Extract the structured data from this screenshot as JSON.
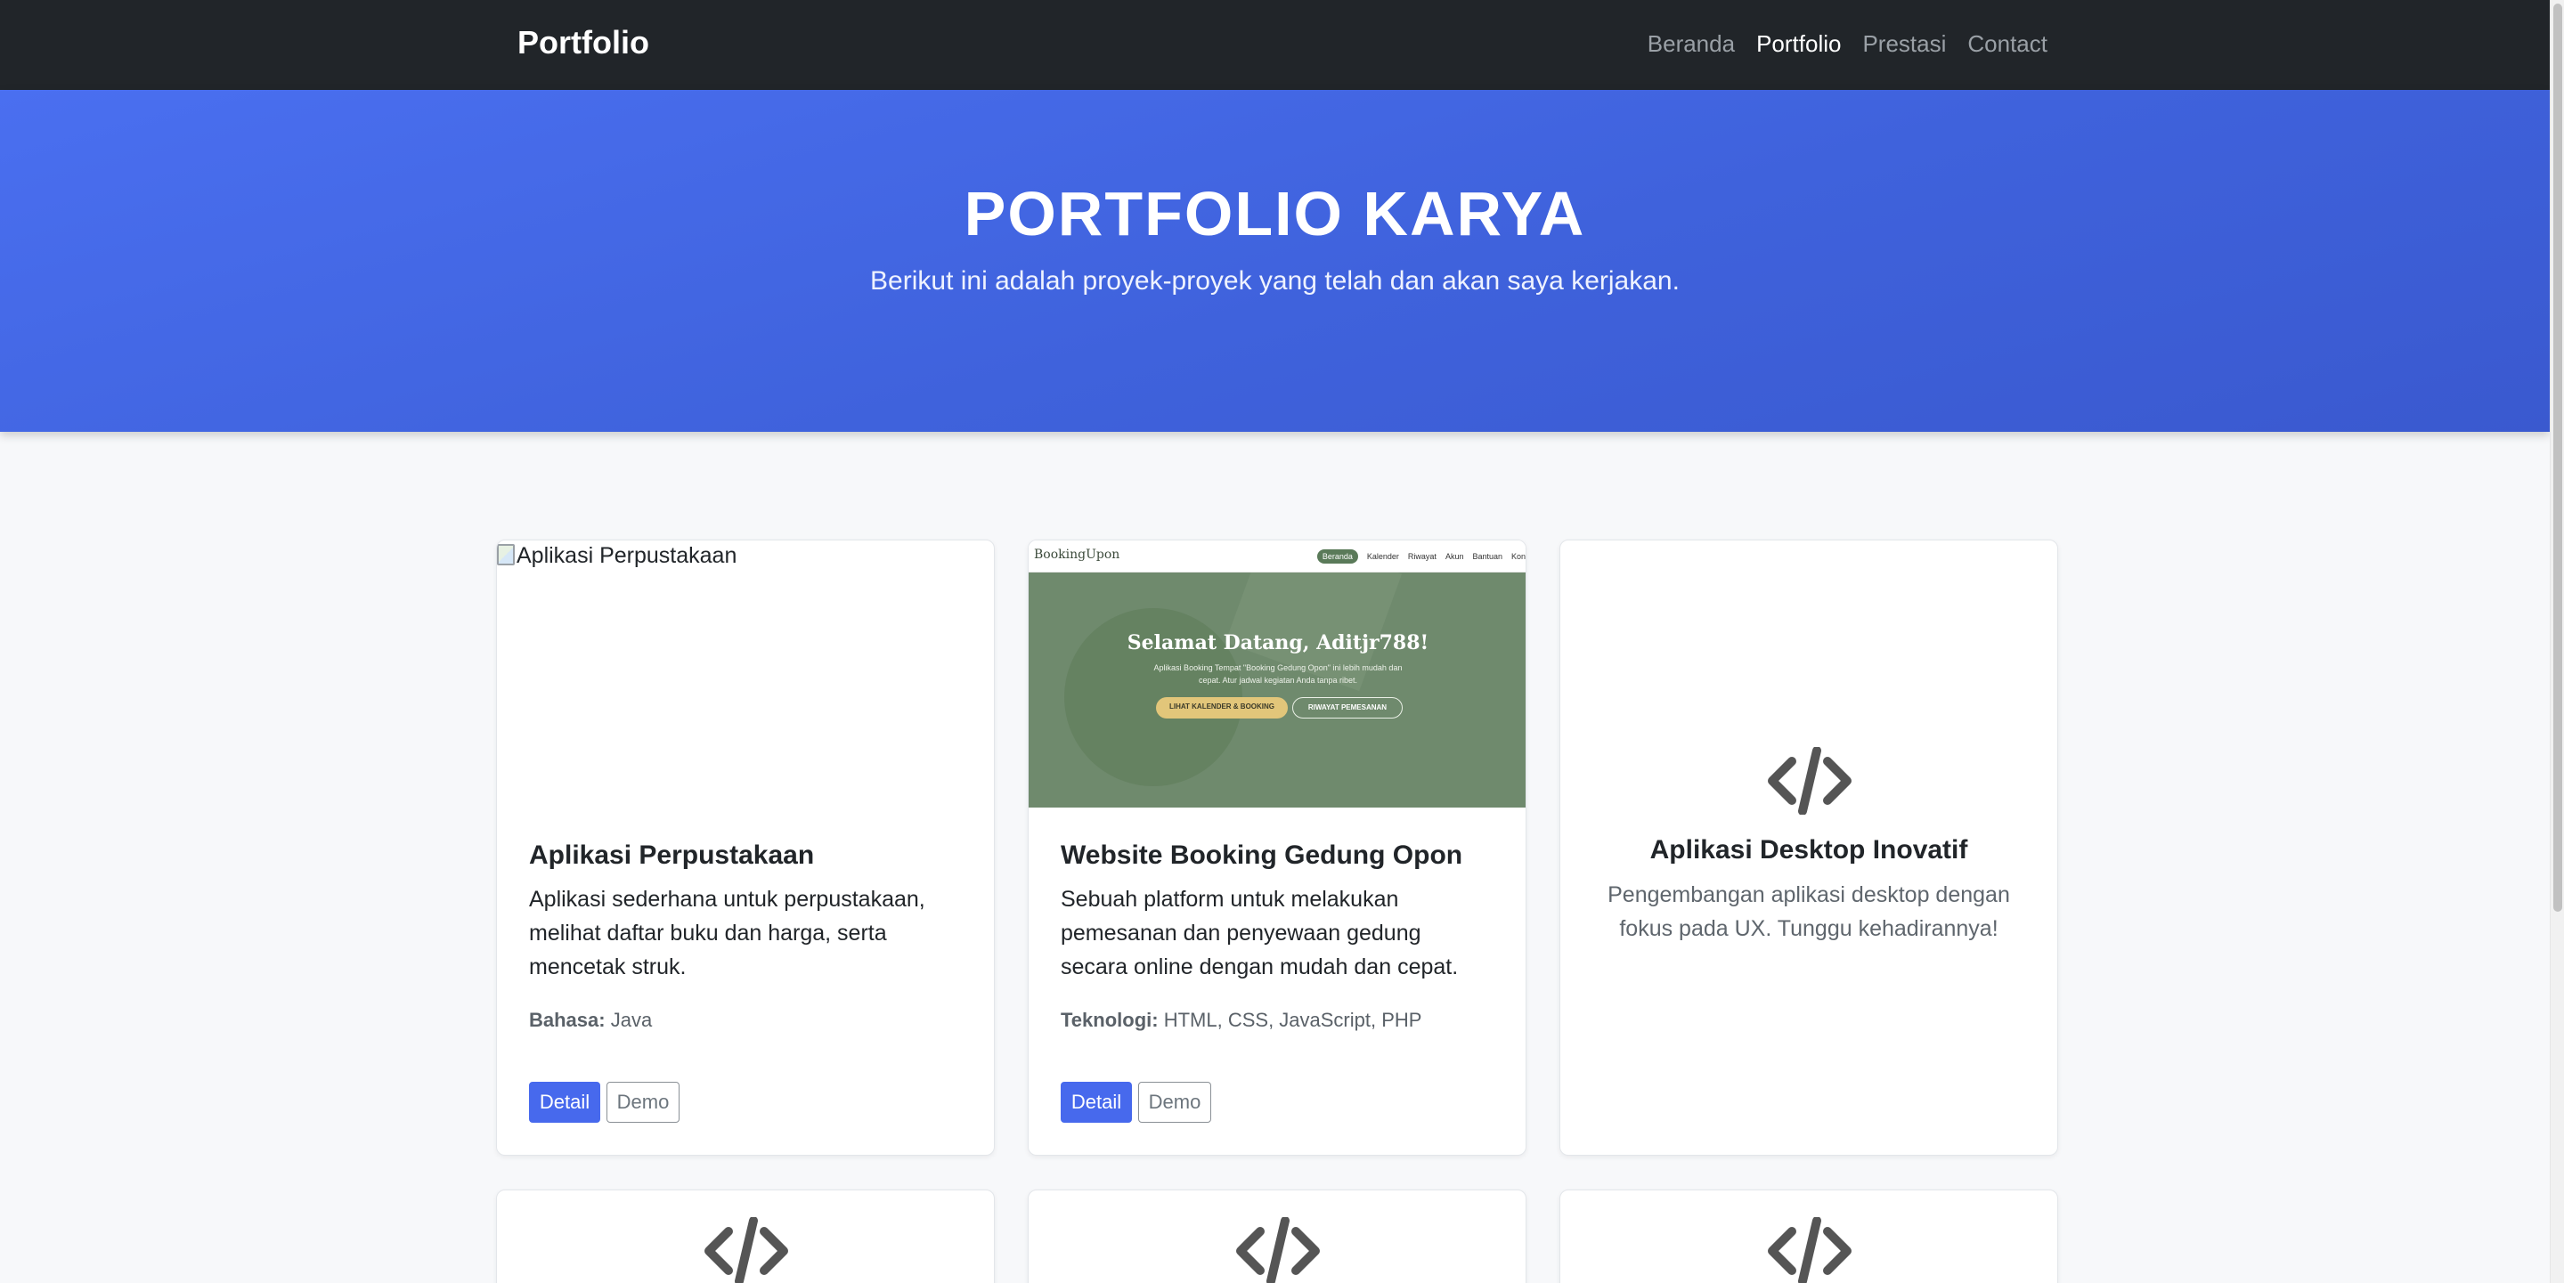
{
  "navbar": {
    "brand": "Portfolio",
    "links": [
      {
        "label": "Beranda",
        "active": false
      },
      {
        "label": "Portfolio",
        "active": true
      },
      {
        "label": "Prestasi",
        "active": false
      },
      {
        "label": "Contact",
        "active": false
      }
    ]
  },
  "hero": {
    "title": "PORTFOLIO KARYA",
    "subtitle": "Berikut ini adalah proyek-proyek yang telah dan akan saya kerjakan."
  },
  "cards": [
    {
      "image_alt": "Aplikasi Perpustakaan",
      "title": "Aplikasi Perpustakaan",
      "description": "Aplikasi sederhana untuk perpustakaan, melihat daftar buku dan harga, serta mencetak struk.",
      "meta_label": "Bahasa:",
      "meta_value": "Java",
      "detail_label": "Detail",
      "demo_label": "Demo"
    },
    {
      "title": "Website Booking Gedung Opon",
      "description": "Sebuah platform untuk melakukan pemesanan dan penyewaan gedung secara online dengan mudah dan cepat.",
      "meta_label": "Teknologi:",
      "meta_value": "HTML, CSS, JavaScript, PHP",
      "detail_label": "Detail",
      "demo_label": "Demo",
      "screenshot": {
        "brand": "BookingUpon",
        "nav": [
          "Beranda",
          "Kalender",
          "Riwayat",
          "Akun",
          "Bantuan",
          "Kon"
        ],
        "title": "Selamat Datang, Aditjr788!",
        "subtitle": "Aplikasi Booking Tempat \"Booking Gedung Opon\" ini lebih mudah dan cepat. Atur jadwal kegiatan Anda tanpa ribet.",
        "button1": "LIHAT KALENDER & BOOKING",
        "button2": "RIWAYAT PEMESANAN"
      }
    },
    {
      "icon": "code-icon",
      "title": "Aplikasi Desktop Inovatif",
      "description": "Pengembangan aplikasi desktop dengan fokus pada UX. Tunggu kehadirannya!"
    }
  ],
  "row2_cards": [
    {
      "icon": "code-icon"
    },
    {
      "icon": "code-icon"
    },
    {
      "icon": "code-icon"
    }
  ],
  "colors": {
    "navbar_bg": "#212529",
    "hero_gradient": [
      "#4a6ff0",
      "#3a59cf"
    ],
    "primary": "#4769ed",
    "page_bg": "#f7f8fa"
  }
}
